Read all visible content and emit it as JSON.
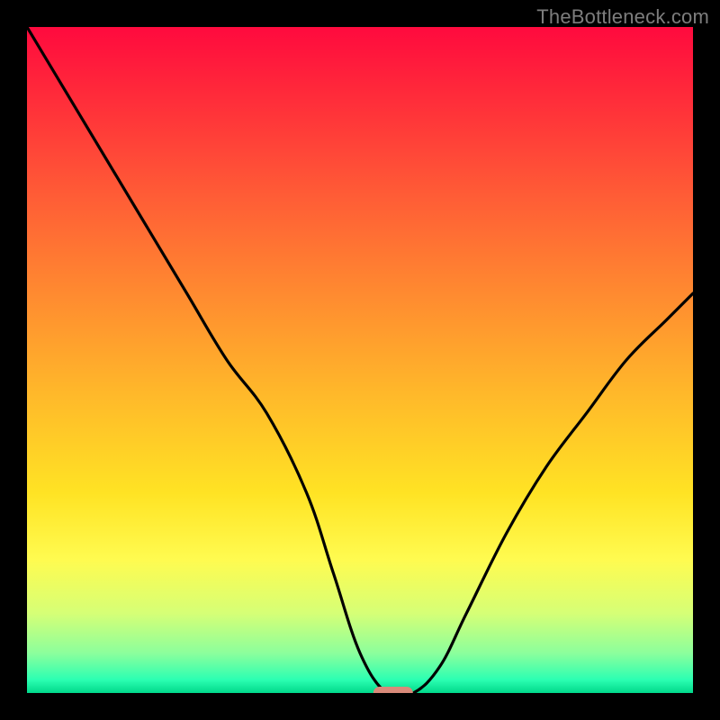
{
  "watermark": "TheBottleneck.com",
  "colors": {
    "background": "#000000",
    "watermark_text": "#7d7d7d",
    "curve": "#000000",
    "marker": "#d98a7a",
    "gradient_top": "#ff0a3e",
    "gradient_bottom": "#00d88a"
  },
  "chart_data": {
    "type": "line",
    "title": "",
    "xlabel": "",
    "ylabel": "",
    "xlim": [
      0,
      100
    ],
    "ylim": [
      0,
      100
    ],
    "grid": false,
    "legend": false,
    "x": [
      0,
      6,
      12,
      18,
      24,
      30,
      36,
      42,
      46,
      50,
      54,
      58,
      62,
      66,
      72,
      78,
      84,
      90,
      96,
      100
    ],
    "y": [
      100,
      90,
      80,
      70,
      60,
      50,
      42,
      30,
      18,
      6,
      0,
      0,
      4,
      12,
      24,
      34,
      42,
      50,
      56,
      60
    ],
    "marker": {
      "x": 55,
      "y": 0,
      "width_frac": 0.06,
      "height_frac": 0.019
    },
    "note": "Background color encodes bottleneck severity (red=high, green=low). Curve is mismatch vs. bottom axis; minimum near x≈55."
  }
}
